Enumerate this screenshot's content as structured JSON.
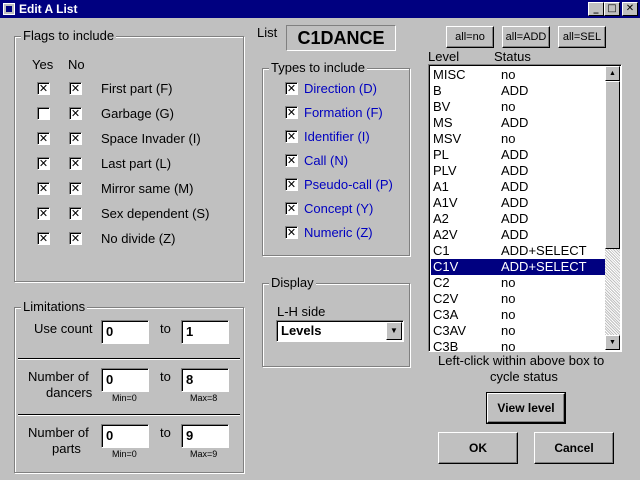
{
  "window": {
    "title": "Edit A List",
    "minimize": "_",
    "maximize": "□",
    "close": "✕"
  },
  "flags": {
    "legend": "Flags to include",
    "col_yes": "Yes",
    "col_no": "No",
    "items": [
      {
        "label": "First part (F)",
        "yes": "✕",
        "no": "✕"
      },
      {
        "label": "Garbage (G)",
        "yes": "",
        "no": "✕"
      },
      {
        "label": "Space Invader (I)",
        "yes": "✕",
        "no": "✕"
      },
      {
        "label": "Last part (L)",
        "yes": "✕",
        "no": "✕"
      },
      {
        "label": "Mirror same (M)",
        "yes": "✕",
        "no": "✕"
      },
      {
        "label": "Sex dependent (S)",
        "yes": "✕",
        "no": "✕"
      },
      {
        "label": "No divide (Z)",
        "yes": "✕",
        "no": "✕"
      }
    ]
  },
  "list_name": {
    "label": "List",
    "value": "C1DANCE"
  },
  "types": {
    "legend": "Types to include",
    "items": [
      {
        "label": "Direction (D)",
        "check": "✕"
      },
      {
        "label": "Formation (F)",
        "check": "✕"
      },
      {
        "label": "Identifier (I)",
        "check": "✕"
      },
      {
        "label": "Call (N)",
        "check": "✕"
      },
      {
        "label": "Pseudo-call (P)",
        "check": "✕"
      },
      {
        "label": "Concept (Y)",
        "check": "✕"
      },
      {
        "label": "Numeric (Z)",
        "check": "✕"
      }
    ]
  },
  "display": {
    "legend": "Display",
    "lh_label": "L-H side",
    "lh_value": "Levels",
    "dropdown_arrow": "▼"
  },
  "limitations": {
    "legend": "Limitations",
    "to_label": "to",
    "use_count": {
      "label": "Use count",
      "from": "0",
      "to": "1"
    },
    "dancers": {
      "label1": "Number of",
      "label2": "dancers",
      "from": "0",
      "to": "8",
      "min": "Min=0",
      "max": "Max=8"
    },
    "parts": {
      "label1": "Number of",
      "label2": "parts",
      "from": "0",
      "to": "9",
      "min": "Min=0",
      "max": "Max=9"
    }
  },
  "buttons": {
    "all_no": "all=no",
    "all_add": "all=ADD",
    "all_sel": "all=SEL",
    "view_level": "View level",
    "ok": "OK",
    "cancel": "Cancel"
  },
  "levels": {
    "col_level": "Level",
    "col_status": "Status",
    "rows": [
      {
        "level": "MISC",
        "status": "no"
      },
      {
        "level": "B",
        "status": "ADD"
      },
      {
        "level": "BV",
        "status": "no"
      },
      {
        "level": "MS",
        "status": "ADD"
      },
      {
        "level": "MSV",
        "status": "no"
      },
      {
        "level": "PL",
        "status": "ADD"
      },
      {
        "level": "PLV",
        "status": "ADD"
      },
      {
        "level": "A1",
        "status": "ADD"
      },
      {
        "level": "A1V",
        "status": "ADD"
      },
      {
        "level": "A2",
        "status": "ADD"
      },
      {
        "level": "A2V",
        "status": "ADD"
      },
      {
        "level": "C1",
        "status": "ADD+SELECT"
      },
      {
        "level": "C1V",
        "status": "ADD+SELECT",
        "selected": true
      },
      {
        "level": "C2",
        "status": "no"
      },
      {
        "level": "C2V",
        "status": "no"
      },
      {
        "level": "C3A",
        "status": "no"
      },
      {
        "level": "C3AV",
        "status": "no"
      },
      {
        "level": "C3B",
        "status": "no"
      }
    ],
    "hint_line1": "Left-click within above box to",
    "hint_line2": "cycle status",
    "scroll_up": "▲",
    "scroll_down": "▼"
  }
}
